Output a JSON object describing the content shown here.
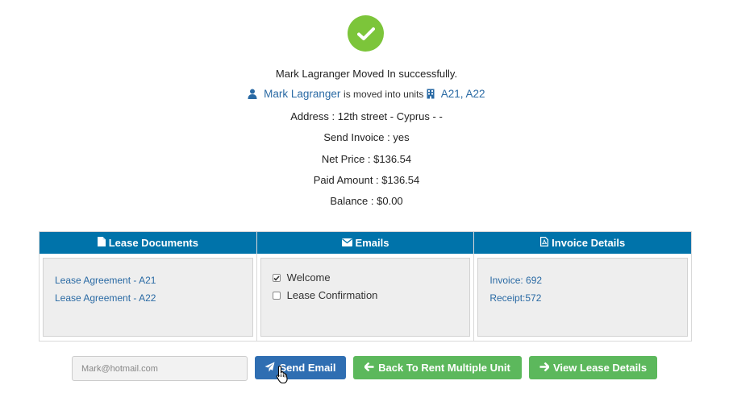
{
  "success": {
    "message": "Mark Lagranger Moved In successfully.",
    "tenant_name": "Mark Lagranger",
    "moved_text": "is moved into units",
    "units": "A21, A22",
    "address": "Address : 12th street - Cyprus - -",
    "send_invoice": "Send Invoice : yes",
    "net_price": "Net Price : $136.54",
    "paid_amount": "Paid Amount : $136.54",
    "balance": "Balance : $0.00"
  },
  "panels": {
    "lease_documents": {
      "title": "Lease Documents",
      "icon": "file-icon",
      "links": [
        "Lease Agreement - A21",
        "Lease Agreement - A22"
      ]
    },
    "emails": {
      "title": "Emails",
      "icon": "envelope-icon",
      "items": [
        {
          "label": "Welcome",
          "checked": true
        },
        {
          "label": "Lease Confirmation",
          "checked": false
        }
      ]
    },
    "invoice_details": {
      "title": "Invoice Details",
      "icon": "pdf-file-icon",
      "links": [
        "Invoice: 692",
        "Receipt:572"
      ]
    }
  },
  "actions": {
    "email_placeholder": "Mark@hotmail.com",
    "send_email_label": "Send Email",
    "back_label": "Back To Rent Multiple Unit",
    "view_lease_label": "View Lease Details"
  },
  "colors": {
    "success_green": "#7cc53a",
    "header_blue": "#0073aa",
    "link_blue": "#2a6aa4",
    "button_blue": "#2f6eb2",
    "button_green": "#5cb85c"
  }
}
